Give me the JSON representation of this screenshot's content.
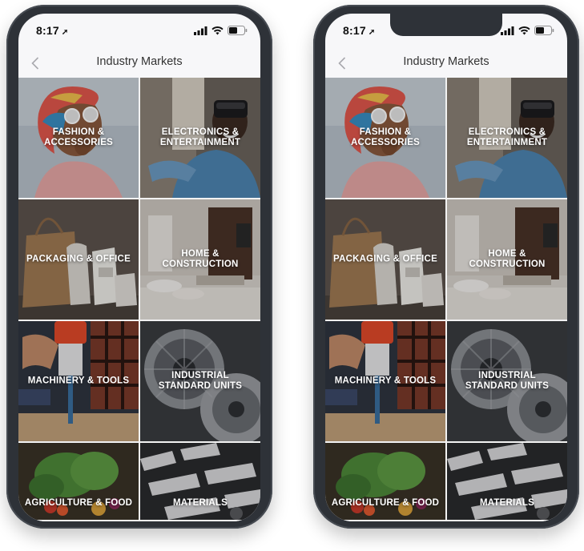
{
  "status_bar": {
    "time": "8:17"
  },
  "nav": {
    "title": "Industry Markets"
  },
  "icons": {
    "back": "chevron-left-icon",
    "location": "location-arrow-icon",
    "signal": "cellular-signal-icon",
    "wifi": "wifi-icon",
    "battery": "battery-icon"
  },
  "colors": {
    "phone_frame": "#2e3238",
    "screen_bg": "#f7f7f9",
    "label_text": "#ffffff"
  },
  "categories": [
    {
      "id": "fashion",
      "label": "FASHION &\nACCESSORIES"
    },
    {
      "id": "electronics",
      "label": "ELECTRONICS &\nENTERTAINMENT"
    },
    {
      "id": "packaging",
      "label": "PACKAGING & OFFICE"
    },
    {
      "id": "home",
      "label": "HOME &\nCONSTRUCTION"
    },
    {
      "id": "machinery",
      "label": "MACHINERY & TOOLS"
    },
    {
      "id": "industrial",
      "label": "INDUSTRIAL\nSTANDARD UNITS"
    },
    {
      "id": "agriculture",
      "label": "AGRICULTURE & FOOD"
    },
    {
      "id": "materials",
      "label": "MATERIALS"
    }
  ]
}
